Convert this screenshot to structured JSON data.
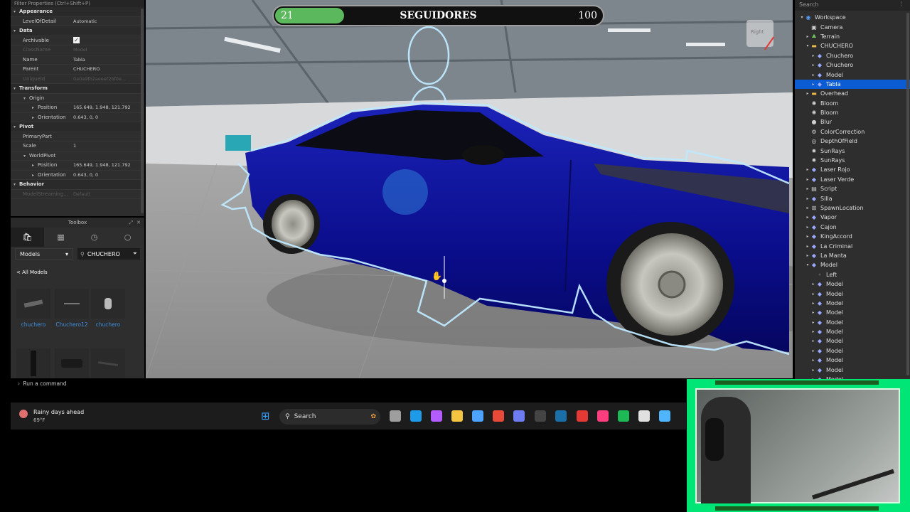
{
  "properties": {
    "filter_label": "Filter Properties (Ctrl+Shift+P)",
    "rows": [
      {
        "type": "section",
        "key": "Appearance"
      },
      {
        "type": "prop",
        "key": "LevelOfDetail",
        "value": "Automatic"
      },
      {
        "type": "section",
        "key": "Data"
      },
      {
        "type": "check",
        "key": "Archivable",
        "value": "✓"
      },
      {
        "type": "dim",
        "key": "ClassName",
        "value": "Model"
      },
      {
        "type": "prop",
        "key": "Name",
        "value": "Tabla"
      },
      {
        "type": "prop",
        "key": "Parent",
        "value": "CHUCHERO"
      },
      {
        "type": "dim",
        "key": "UniqueId",
        "value": "0a0a9fb2aeeef2bf0e..."
      },
      {
        "type": "section",
        "key": "Transform"
      },
      {
        "type": "group",
        "key": "Origin"
      },
      {
        "type": "sub2",
        "key": "Position",
        "value": "165.649, 1.948, 121.792"
      },
      {
        "type": "sub2",
        "key": "Orientation",
        "value": "0.643, 0, 0"
      },
      {
        "type": "section",
        "key": "Pivot"
      },
      {
        "type": "prop",
        "key": "PrimaryPart",
        "value": ""
      },
      {
        "type": "prop",
        "key": "Scale",
        "value": "1"
      },
      {
        "type": "group",
        "key": "WorldPivot"
      },
      {
        "type": "sub2",
        "key": "Position",
        "value": "165.649, 1.948, 121.792"
      },
      {
        "type": "sub2",
        "key": "Orientation",
        "value": "0.643, 0, 0"
      },
      {
        "type": "section",
        "key": "Behavior"
      },
      {
        "type": "dim",
        "key": "ModelStreaming...",
        "value": "Default"
      }
    ]
  },
  "toolbox": {
    "title": "Toolbox",
    "category": "Models",
    "search_value": "CHUCHERO",
    "breadcrumb": "< All Models",
    "items": [
      {
        "label": "chuchero"
      },
      {
        "label": "Chuchero12"
      },
      {
        "label": "chuchero"
      }
    ]
  },
  "hud": {
    "left_value": "21",
    "title": "SEGUIDORES",
    "right_value": "100",
    "progress": 0.21
  },
  "viewcube_label": "Right",
  "explorer": {
    "search_placeholder": "Search",
    "items": [
      {
        "label": "Workspace",
        "indent": 0,
        "arrow": "▾",
        "icon": "workspace-icon",
        "color": "#5aa0ff"
      },
      {
        "label": "Camera",
        "indent": 1,
        "arrow": "",
        "icon": "camera-icon",
        "color": "#cfcfcf"
      },
      {
        "label": "Terrain",
        "indent": 1,
        "arrow": "▸",
        "icon": "terrain-icon",
        "color": "#6fbf5f"
      },
      {
        "label": "CHUCHERO",
        "indent": 1,
        "arrow": "▾",
        "icon": "folder-icon",
        "color": "#e9b949"
      },
      {
        "label": "Chuchero",
        "indent": 2,
        "arrow": "▸",
        "icon": "model-icon",
        "color": "#9aa8ff"
      },
      {
        "label": "Chuchero",
        "indent": 2,
        "arrow": "▸",
        "icon": "model-icon",
        "color": "#9aa8ff"
      },
      {
        "label": "Model",
        "indent": 2,
        "arrow": "▸",
        "icon": "model-icon",
        "color": "#9aa8ff"
      },
      {
        "label": "Tabla",
        "indent": 2,
        "arrow": "▸",
        "icon": "model-icon",
        "color": "#9aa8ff",
        "selected": true
      },
      {
        "label": "Overhead",
        "indent": 1,
        "arrow": "▸",
        "icon": "folder-icon",
        "color": "#e9b949"
      },
      {
        "label": "Bloom",
        "indent": 1,
        "arrow": "",
        "icon": "effect-icon",
        "color": "#cfcfcf"
      },
      {
        "label": "Bloom",
        "indent": 1,
        "arrow": "",
        "icon": "effect-icon",
        "color": "#cfcfcf"
      },
      {
        "label": "Blur",
        "indent": 1,
        "arrow": "",
        "icon": "drop-icon",
        "color": "#cfcfcf"
      },
      {
        "label": "ColorCorrection",
        "indent": 1,
        "arrow": "",
        "icon": "gear-icon",
        "color": "#cfcfcf"
      },
      {
        "label": "DepthOfField",
        "indent": 1,
        "arrow": "",
        "icon": "lens-icon",
        "color": "#cfcfcf"
      },
      {
        "label": "SunRays",
        "indent": 1,
        "arrow": "",
        "icon": "sun-icon",
        "color": "#cfcfcf"
      },
      {
        "label": "SunRays",
        "indent": 1,
        "arrow": "",
        "icon": "sun-icon",
        "color": "#cfcfcf"
      },
      {
        "label": "Laser Rojo",
        "indent": 1,
        "arrow": "▸",
        "icon": "model-icon",
        "color": "#9aa8ff"
      },
      {
        "label": "Laser Verde",
        "indent": 1,
        "arrow": "▸",
        "icon": "model-icon",
        "color": "#9aa8ff"
      },
      {
        "label": "Script",
        "indent": 1,
        "arrow": "▸",
        "icon": "script-icon",
        "color": "#cfcfcf"
      },
      {
        "label": "Silla",
        "indent": 1,
        "arrow": "▸",
        "icon": "model-icon",
        "color": "#9aa8ff"
      },
      {
        "label": "SpawnLocation",
        "indent": 1,
        "arrow": "▸",
        "icon": "spawn-icon",
        "color": "#cfcfcf"
      },
      {
        "label": "Vapor",
        "indent": 1,
        "arrow": "▸",
        "icon": "model-icon",
        "color": "#9aa8ff"
      },
      {
        "label": "Cajon",
        "indent": 1,
        "arrow": "▸",
        "icon": "model-icon",
        "color": "#9aa8ff"
      },
      {
        "label": "KingAccord",
        "indent": 1,
        "arrow": "▸",
        "icon": "model-icon",
        "color": "#9aa8ff"
      },
      {
        "label": "La Criminal",
        "indent": 1,
        "arrow": "▸",
        "icon": "model-icon",
        "color": "#9aa8ff"
      },
      {
        "label": "La Manta",
        "indent": 1,
        "arrow": "▸",
        "icon": "model-icon",
        "color": "#9aa8ff"
      },
      {
        "label": "Model",
        "indent": 1,
        "arrow": "▾",
        "icon": "model-icon",
        "color": "#9aa8ff"
      },
      {
        "label": "Left",
        "indent": 2,
        "arrow": "",
        "icon": "attachment-icon",
        "color": "#cfcfcf"
      },
      {
        "label": "Model",
        "indent": 2,
        "arrow": "▸",
        "icon": "model-icon",
        "color": "#9aa8ff"
      },
      {
        "label": "Model",
        "indent": 2,
        "arrow": "▸",
        "icon": "model-icon",
        "color": "#9aa8ff"
      },
      {
        "label": "Model",
        "indent": 2,
        "arrow": "▸",
        "icon": "model-icon",
        "color": "#9aa8ff"
      },
      {
        "label": "Model",
        "indent": 2,
        "arrow": "▸",
        "icon": "model-icon",
        "color": "#9aa8ff"
      },
      {
        "label": "Model",
        "indent": 2,
        "arrow": "▸",
        "icon": "model-icon",
        "color": "#9aa8ff"
      },
      {
        "label": "Model",
        "indent": 2,
        "arrow": "▸",
        "icon": "model-icon",
        "color": "#9aa8ff"
      },
      {
        "label": "Model",
        "indent": 2,
        "arrow": "▸",
        "icon": "model-icon",
        "color": "#9aa8ff"
      },
      {
        "label": "Model",
        "indent": 2,
        "arrow": "▸",
        "icon": "model-icon",
        "color": "#9aa8ff"
      },
      {
        "label": "Model",
        "indent": 2,
        "arrow": "▸",
        "icon": "model-icon",
        "color": "#9aa8ff"
      },
      {
        "label": "Model",
        "indent": 2,
        "arrow": "▸",
        "icon": "model-icon",
        "color": "#9aa8ff"
      },
      {
        "label": "Model",
        "indent": 2,
        "arrow": "▸",
        "icon": "model-icon",
        "color": "#9aa8ff"
      }
    ]
  },
  "command_bar": {
    "placeholder": "Run a command"
  },
  "taskbar": {
    "weather_title": "Rainy days ahead",
    "weather_temp": "69°F",
    "search_label": "Search",
    "apps": [
      {
        "name": "start-icon",
        "color": "#3aa0ff"
      },
      {
        "name": "task-view-icon",
        "color": "#9e9e9e"
      },
      {
        "name": "edge-icon",
        "color": "#1e9be8"
      },
      {
        "name": "copilot-icon",
        "color": "#b35cff"
      },
      {
        "name": "file-explorer-icon",
        "color": "#f5c542"
      },
      {
        "name": "store-icon",
        "color": "#4ea3ff"
      },
      {
        "name": "chrome-icon",
        "color": "#e84a3a"
      },
      {
        "name": "discord-icon",
        "color": "#6d7cf0"
      },
      {
        "name": "obs-icon",
        "color": "#444444"
      },
      {
        "name": "steam-icon",
        "color": "#1b6fa8"
      },
      {
        "name": "tf-icon",
        "color": "#e53935"
      },
      {
        "name": "tiktok-icon",
        "color": "#ff3d7f"
      },
      {
        "name": "spotify-icon",
        "color": "#1db954"
      },
      {
        "name": "roblox-studio-icon",
        "color": "#e0e0e0"
      },
      {
        "name": "notepad-icon",
        "color": "#4fb5ff"
      }
    ]
  }
}
